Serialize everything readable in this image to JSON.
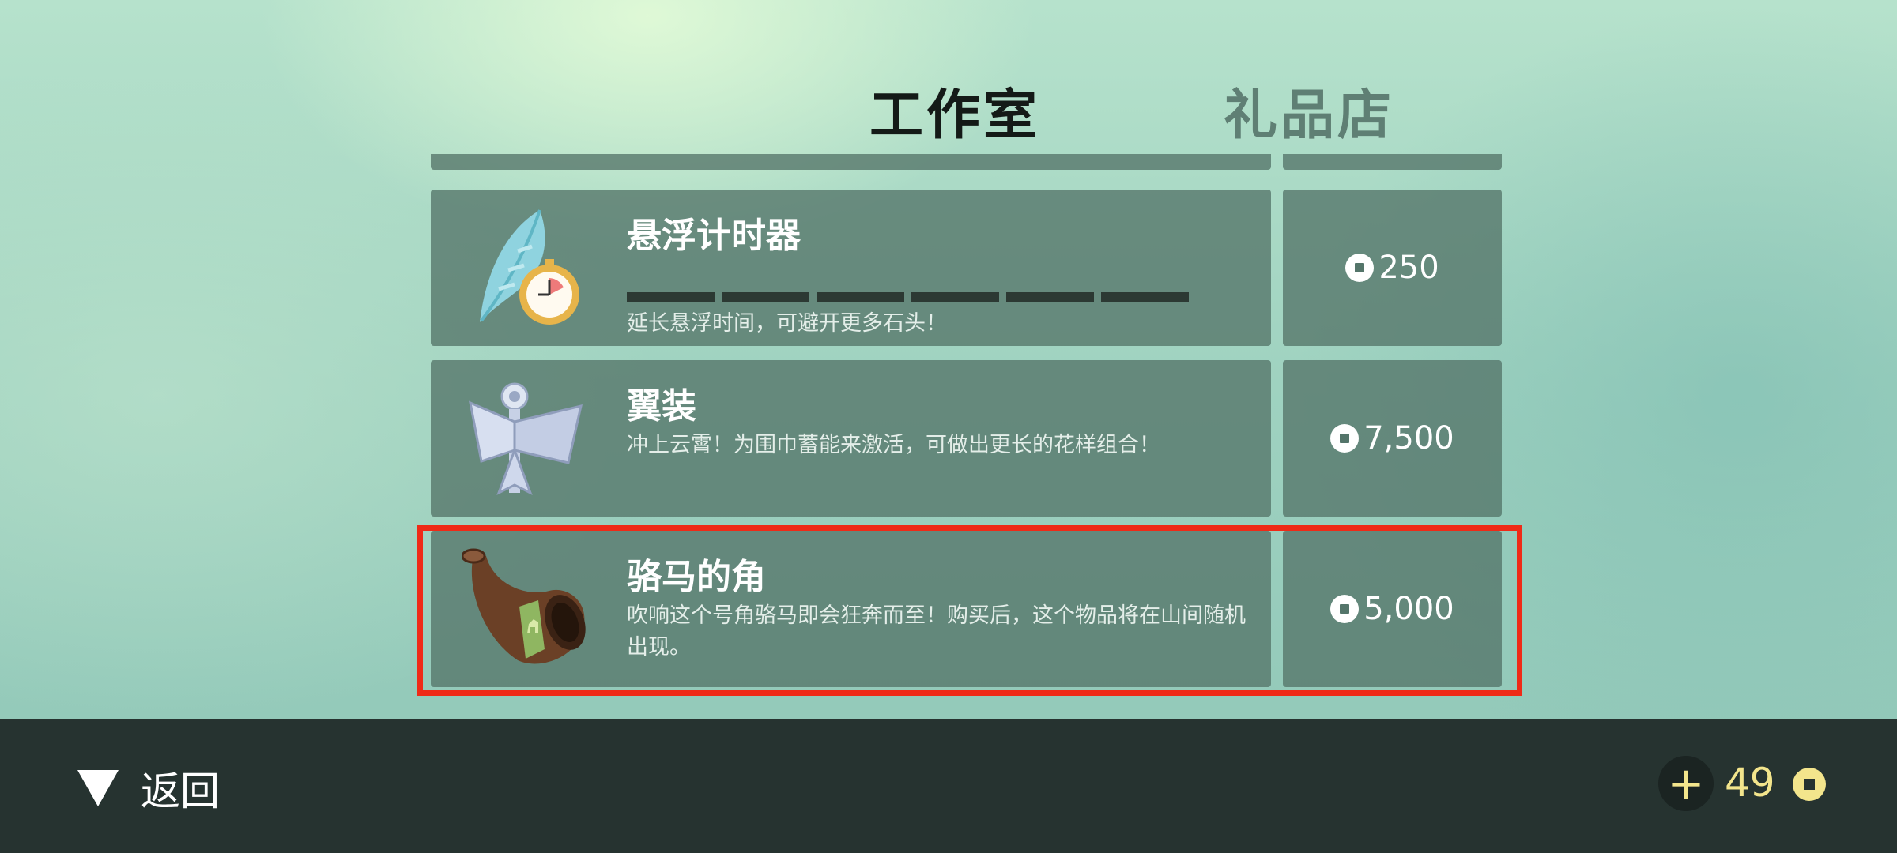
{
  "tabs": [
    {
      "label": "工作室",
      "active": true
    },
    {
      "label": "礼品店",
      "active": false
    }
  ],
  "items": [
    {
      "title": "悬浮计时器",
      "description": "延长悬浮时间，可避开更多石头！",
      "price": "250",
      "icon": "feather-stopwatch-icon",
      "upgrade_segments": 6
    },
    {
      "title": "翼装",
      "description": "冲上云霄！为围巾蓄能来激活，可做出更长的花样组合！",
      "price": "7,500",
      "icon": "wingsuit-icon"
    },
    {
      "title": "骆马的角",
      "description": "吹响这个号角骆马即会狂奔而至！购买后，这个物品将在山间随机出现。",
      "price": "5,000",
      "icon": "llama-horn-icon",
      "highlighted": true
    }
  ],
  "footer": {
    "back_label": "返回",
    "coin_balance": "49"
  },
  "colors": {
    "highlight": "#ef2a17",
    "coin": "#f3e58c",
    "bottom_bar": "#263330"
  }
}
